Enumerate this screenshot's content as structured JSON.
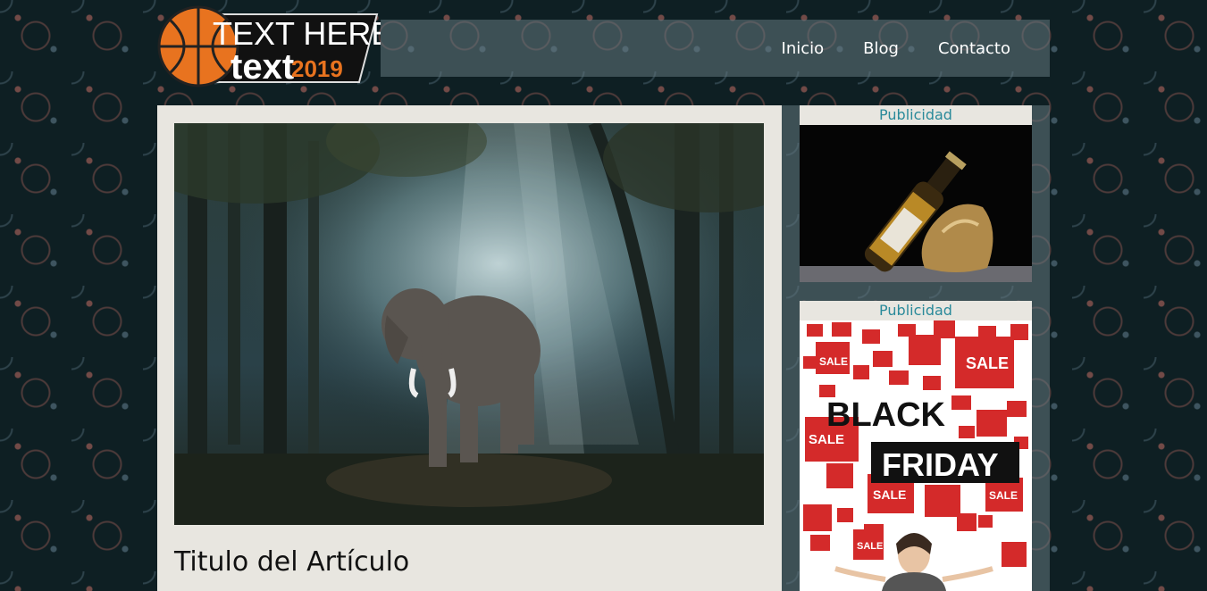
{
  "logo": {
    "line1": "TEXT HERE",
    "line2a": "text",
    "line2b": "2019"
  },
  "nav": {
    "items": [
      {
        "label": "Inicio"
      },
      {
        "label": "Blog"
      },
      {
        "label": "Contacto"
      }
    ]
  },
  "article": {
    "title": "Titulo del Artículo"
  },
  "sidebar": {
    "ads": [
      {
        "label": "Publicidad"
      },
      {
        "label": "Publicidad",
        "headline1": "BLACK",
        "headline2": "FRIDAY",
        "tag": "SALE"
      }
    ]
  },
  "colors": {
    "background": "#0e1f23",
    "panel": "#e8e6e0",
    "accent": "#2a8a9a",
    "sale_red": "#d42a2a",
    "logo_orange": "#e8731f"
  }
}
